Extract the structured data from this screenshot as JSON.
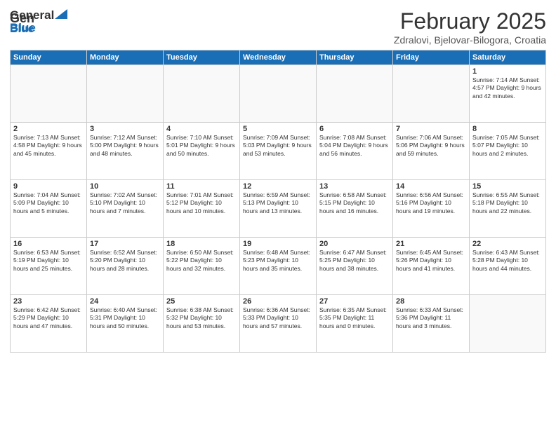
{
  "logo": {
    "general": "General",
    "blue": "Blue"
  },
  "title": "February 2025",
  "location": "Zdralovi, Bjelovar-Bilogora, Croatia",
  "weekdays": [
    "Sunday",
    "Monday",
    "Tuesday",
    "Wednesday",
    "Thursday",
    "Friday",
    "Saturday"
  ],
  "weeks": [
    [
      {
        "day": "",
        "info": ""
      },
      {
        "day": "",
        "info": ""
      },
      {
        "day": "",
        "info": ""
      },
      {
        "day": "",
        "info": ""
      },
      {
        "day": "",
        "info": ""
      },
      {
        "day": "",
        "info": ""
      },
      {
        "day": "1",
        "info": "Sunrise: 7:14 AM\nSunset: 4:57 PM\nDaylight: 9 hours and 42 minutes."
      }
    ],
    [
      {
        "day": "2",
        "info": "Sunrise: 7:13 AM\nSunset: 4:58 PM\nDaylight: 9 hours and 45 minutes."
      },
      {
        "day": "3",
        "info": "Sunrise: 7:12 AM\nSunset: 5:00 PM\nDaylight: 9 hours and 48 minutes."
      },
      {
        "day": "4",
        "info": "Sunrise: 7:10 AM\nSunset: 5:01 PM\nDaylight: 9 hours and 50 minutes."
      },
      {
        "day": "5",
        "info": "Sunrise: 7:09 AM\nSunset: 5:03 PM\nDaylight: 9 hours and 53 minutes."
      },
      {
        "day": "6",
        "info": "Sunrise: 7:08 AM\nSunset: 5:04 PM\nDaylight: 9 hours and 56 minutes."
      },
      {
        "day": "7",
        "info": "Sunrise: 7:06 AM\nSunset: 5:06 PM\nDaylight: 9 hours and 59 minutes."
      },
      {
        "day": "8",
        "info": "Sunrise: 7:05 AM\nSunset: 5:07 PM\nDaylight: 10 hours and 2 minutes."
      }
    ],
    [
      {
        "day": "9",
        "info": "Sunrise: 7:04 AM\nSunset: 5:09 PM\nDaylight: 10 hours and 5 minutes."
      },
      {
        "day": "10",
        "info": "Sunrise: 7:02 AM\nSunset: 5:10 PM\nDaylight: 10 hours and 7 minutes."
      },
      {
        "day": "11",
        "info": "Sunrise: 7:01 AM\nSunset: 5:12 PM\nDaylight: 10 hours and 10 minutes."
      },
      {
        "day": "12",
        "info": "Sunrise: 6:59 AM\nSunset: 5:13 PM\nDaylight: 10 hours and 13 minutes."
      },
      {
        "day": "13",
        "info": "Sunrise: 6:58 AM\nSunset: 5:15 PM\nDaylight: 10 hours and 16 minutes."
      },
      {
        "day": "14",
        "info": "Sunrise: 6:56 AM\nSunset: 5:16 PM\nDaylight: 10 hours and 19 minutes."
      },
      {
        "day": "15",
        "info": "Sunrise: 6:55 AM\nSunset: 5:18 PM\nDaylight: 10 hours and 22 minutes."
      }
    ],
    [
      {
        "day": "16",
        "info": "Sunrise: 6:53 AM\nSunset: 5:19 PM\nDaylight: 10 hours and 25 minutes."
      },
      {
        "day": "17",
        "info": "Sunrise: 6:52 AM\nSunset: 5:20 PM\nDaylight: 10 hours and 28 minutes."
      },
      {
        "day": "18",
        "info": "Sunrise: 6:50 AM\nSunset: 5:22 PM\nDaylight: 10 hours and 32 minutes."
      },
      {
        "day": "19",
        "info": "Sunrise: 6:48 AM\nSunset: 5:23 PM\nDaylight: 10 hours and 35 minutes."
      },
      {
        "day": "20",
        "info": "Sunrise: 6:47 AM\nSunset: 5:25 PM\nDaylight: 10 hours and 38 minutes."
      },
      {
        "day": "21",
        "info": "Sunrise: 6:45 AM\nSunset: 5:26 PM\nDaylight: 10 hours and 41 minutes."
      },
      {
        "day": "22",
        "info": "Sunrise: 6:43 AM\nSunset: 5:28 PM\nDaylight: 10 hours and 44 minutes."
      }
    ],
    [
      {
        "day": "23",
        "info": "Sunrise: 6:42 AM\nSunset: 5:29 PM\nDaylight: 10 hours and 47 minutes."
      },
      {
        "day": "24",
        "info": "Sunrise: 6:40 AM\nSunset: 5:31 PM\nDaylight: 10 hours and 50 minutes."
      },
      {
        "day": "25",
        "info": "Sunrise: 6:38 AM\nSunset: 5:32 PM\nDaylight: 10 hours and 53 minutes."
      },
      {
        "day": "26",
        "info": "Sunrise: 6:36 AM\nSunset: 5:33 PM\nDaylight: 10 hours and 57 minutes."
      },
      {
        "day": "27",
        "info": "Sunrise: 6:35 AM\nSunset: 5:35 PM\nDaylight: 11 hours and 0 minutes."
      },
      {
        "day": "28",
        "info": "Sunrise: 6:33 AM\nSunset: 5:36 PM\nDaylight: 11 hours and 3 minutes."
      },
      {
        "day": "",
        "info": ""
      }
    ]
  ]
}
